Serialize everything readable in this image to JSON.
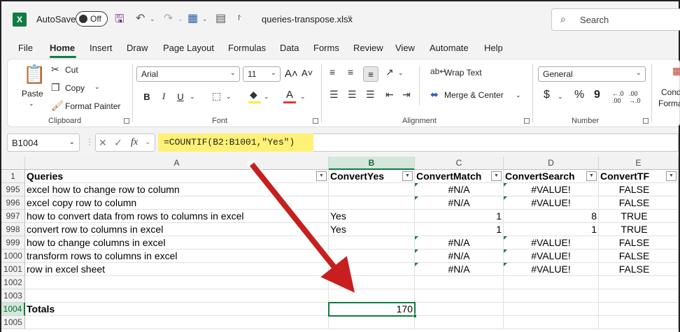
{
  "titlebar": {
    "logo": "X",
    "autosave_label": "AutoSave",
    "autosave_state": "Off",
    "filename": "queries-transpose.xlsx",
    "search_placeholder": "Search"
  },
  "menu": {
    "tabs": [
      "File",
      "Home",
      "Insert",
      "Draw",
      "Page Layout",
      "Formulas",
      "Data",
      "Forms",
      "Review",
      "View",
      "Automate",
      "Help"
    ],
    "active": "Home"
  },
  "ribbon": {
    "clipboard": {
      "paste": "Paste",
      "cut": "Cut",
      "copy": "Copy",
      "format_painter": "Format Painter",
      "label": "Clipboard"
    },
    "font": {
      "name": "Arial",
      "size": "11",
      "label": "Font",
      "bold": "B",
      "italic": "I",
      "underline": "U"
    },
    "alignment": {
      "wrap_text": "Wrap Text",
      "merge_center": "Merge & Center",
      "label": "Alignment"
    },
    "number": {
      "format": "General",
      "label": "Number",
      "currency": "$",
      "percent": "%",
      "comma": "9"
    },
    "styles": {
      "conditional_1": "Cond",
      "conditional_2": "Forma"
    }
  },
  "formula_bar": {
    "name_box": "B1004",
    "fx": "fx",
    "formula": "=COUNTIF(B2:B1001,\"Yes\")"
  },
  "sheet": {
    "columns": [
      "A",
      "B",
      "C",
      "D",
      "E"
    ],
    "selected_column": "B",
    "header_row": {
      "row": "1",
      "cells": [
        "Queries",
        "ConvertYes",
        "ConvertMatch",
        "ConvertSearch",
        "ConvertTF"
      ]
    },
    "rows": [
      {
        "row": "995",
        "cells": [
          "excel how to change row to column",
          "",
          "#N/A",
          "#VALUE!",
          "FALSE"
        ]
      },
      {
        "row": "996",
        "cells": [
          "excel copy row to column",
          "",
          "#N/A",
          "#VALUE!",
          "FALSE"
        ]
      },
      {
        "row": "997",
        "cells": [
          "how to convert data from rows to columns in excel",
          "Yes",
          "1",
          "8",
          "TRUE"
        ]
      },
      {
        "row": "998",
        "cells": [
          "convert row to columns in excel",
          "Yes",
          "1",
          "1",
          "TRUE"
        ]
      },
      {
        "row": "999",
        "cells": [
          "how to change columns in excel",
          "",
          "#N/A",
          "#VALUE!",
          "FALSE"
        ]
      },
      {
        "row": "1000",
        "cells": [
          "transform rows to columns in excel",
          "",
          "#N/A",
          "#VALUE!",
          "FALSE"
        ]
      },
      {
        "row": "1001",
        "cells": [
          "row in excel sheet",
          "",
          "#N/A",
          "#VALUE!",
          "FALSE"
        ]
      },
      {
        "row": "1002",
        "cells": [
          "",
          "",
          "",
          "",
          ""
        ]
      },
      {
        "row": "1003",
        "cells": [
          "",
          "",
          "",
          "",
          ""
        ]
      },
      {
        "row": "1004",
        "cells": [
          "Totals",
          "170",
          "",
          "",
          ""
        ]
      },
      {
        "row": "1005",
        "cells": [
          "",
          "",
          "",
          "",
          ""
        ]
      }
    ],
    "selected_row": "1004"
  },
  "colors": {
    "accent": "#107c41",
    "formula_highlight": "#fff176",
    "arrow": "#c81e1e"
  }
}
